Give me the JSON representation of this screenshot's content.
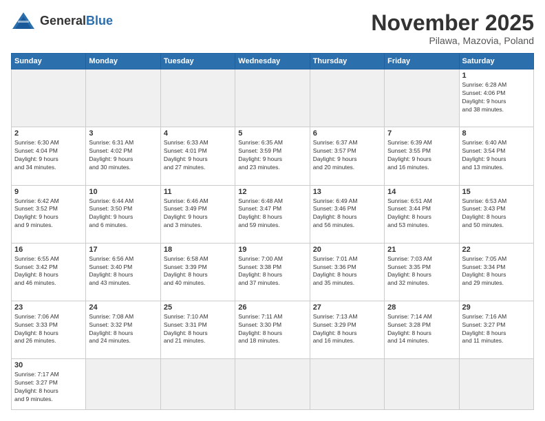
{
  "header": {
    "logo_general": "General",
    "logo_blue": "Blue",
    "month": "November 2025",
    "location": "Pilawa, Mazovia, Poland"
  },
  "days_of_week": [
    "Sunday",
    "Monday",
    "Tuesday",
    "Wednesday",
    "Thursday",
    "Friday",
    "Saturday"
  ],
  "weeks": [
    [
      {
        "day": "",
        "empty": true
      },
      {
        "day": "",
        "empty": true
      },
      {
        "day": "",
        "empty": true
      },
      {
        "day": "",
        "empty": true
      },
      {
        "day": "",
        "empty": true
      },
      {
        "day": "",
        "empty": true
      },
      {
        "day": "1",
        "info": "Sunrise: 6:28 AM\nSunset: 4:06 PM\nDaylight: 9 hours\nand 38 minutes."
      }
    ],
    [
      {
        "day": "2",
        "info": "Sunrise: 6:30 AM\nSunset: 4:04 PM\nDaylight: 9 hours\nand 34 minutes."
      },
      {
        "day": "3",
        "info": "Sunrise: 6:31 AM\nSunset: 4:02 PM\nDaylight: 9 hours\nand 30 minutes."
      },
      {
        "day": "4",
        "info": "Sunrise: 6:33 AM\nSunset: 4:01 PM\nDaylight: 9 hours\nand 27 minutes."
      },
      {
        "day": "5",
        "info": "Sunrise: 6:35 AM\nSunset: 3:59 PM\nDaylight: 9 hours\nand 23 minutes."
      },
      {
        "day": "6",
        "info": "Sunrise: 6:37 AM\nSunset: 3:57 PM\nDaylight: 9 hours\nand 20 minutes."
      },
      {
        "day": "7",
        "info": "Sunrise: 6:39 AM\nSunset: 3:55 PM\nDaylight: 9 hours\nand 16 minutes."
      },
      {
        "day": "8",
        "info": "Sunrise: 6:40 AM\nSunset: 3:54 PM\nDaylight: 9 hours\nand 13 minutes."
      }
    ],
    [
      {
        "day": "9",
        "info": "Sunrise: 6:42 AM\nSunset: 3:52 PM\nDaylight: 9 hours\nand 9 minutes."
      },
      {
        "day": "10",
        "info": "Sunrise: 6:44 AM\nSunset: 3:50 PM\nDaylight: 9 hours\nand 6 minutes."
      },
      {
        "day": "11",
        "info": "Sunrise: 6:46 AM\nSunset: 3:49 PM\nDaylight: 9 hours\nand 3 minutes."
      },
      {
        "day": "12",
        "info": "Sunrise: 6:48 AM\nSunset: 3:47 PM\nDaylight: 8 hours\nand 59 minutes."
      },
      {
        "day": "13",
        "info": "Sunrise: 6:49 AM\nSunset: 3:46 PM\nDaylight: 8 hours\nand 56 minutes."
      },
      {
        "day": "14",
        "info": "Sunrise: 6:51 AM\nSunset: 3:44 PM\nDaylight: 8 hours\nand 53 minutes."
      },
      {
        "day": "15",
        "info": "Sunrise: 6:53 AM\nSunset: 3:43 PM\nDaylight: 8 hours\nand 50 minutes."
      }
    ],
    [
      {
        "day": "16",
        "info": "Sunrise: 6:55 AM\nSunset: 3:42 PM\nDaylight: 8 hours\nand 46 minutes."
      },
      {
        "day": "17",
        "info": "Sunrise: 6:56 AM\nSunset: 3:40 PM\nDaylight: 8 hours\nand 43 minutes."
      },
      {
        "day": "18",
        "info": "Sunrise: 6:58 AM\nSunset: 3:39 PM\nDaylight: 8 hours\nand 40 minutes."
      },
      {
        "day": "19",
        "info": "Sunrise: 7:00 AM\nSunset: 3:38 PM\nDaylight: 8 hours\nand 37 minutes."
      },
      {
        "day": "20",
        "info": "Sunrise: 7:01 AM\nSunset: 3:36 PM\nDaylight: 8 hours\nand 35 minutes."
      },
      {
        "day": "21",
        "info": "Sunrise: 7:03 AM\nSunset: 3:35 PM\nDaylight: 8 hours\nand 32 minutes."
      },
      {
        "day": "22",
        "info": "Sunrise: 7:05 AM\nSunset: 3:34 PM\nDaylight: 8 hours\nand 29 minutes."
      }
    ],
    [
      {
        "day": "23",
        "info": "Sunrise: 7:06 AM\nSunset: 3:33 PM\nDaylight: 8 hours\nand 26 minutes."
      },
      {
        "day": "24",
        "info": "Sunrise: 7:08 AM\nSunset: 3:32 PM\nDaylight: 8 hours\nand 24 minutes."
      },
      {
        "day": "25",
        "info": "Sunrise: 7:10 AM\nSunset: 3:31 PM\nDaylight: 8 hours\nand 21 minutes."
      },
      {
        "day": "26",
        "info": "Sunrise: 7:11 AM\nSunset: 3:30 PM\nDaylight: 8 hours\nand 18 minutes."
      },
      {
        "day": "27",
        "info": "Sunrise: 7:13 AM\nSunset: 3:29 PM\nDaylight: 8 hours\nand 16 minutes."
      },
      {
        "day": "28",
        "info": "Sunrise: 7:14 AM\nSunset: 3:28 PM\nDaylight: 8 hours\nand 14 minutes."
      },
      {
        "day": "29",
        "info": "Sunrise: 7:16 AM\nSunset: 3:27 PM\nDaylight: 8 hours\nand 11 minutes."
      }
    ],
    [
      {
        "day": "30",
        "info": "Sunrise: 7:17 AM\nSunset: 3:27 PM\nDaylight: 8 hours\nand 9 minutes.",
        "last": true
      },
      {
        "day": "",
        "empty": true,
        "last": true
      },
      {
        "day": "",
        "empty": true,
        "last": true
      },
      {
        "day": "",
        "empty": true,
        "last": true
      },
      {
        "day": "",
        "empty": true,
        "last": true
      },
      {
        "day": "",
        "empty": true,
        "last": true
      },
      {
        "day": "",
        "empty": true,
        "last": true
      }
    ]
  ]
}
